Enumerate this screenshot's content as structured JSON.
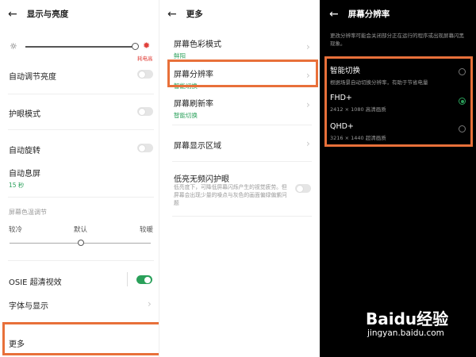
{
  "panel1": {
    "title": "显示与亮度",
    "power_label": "耗电高",
    "auto_brightness": "自动调节亮度",
    "eye_protection": "护眼模式",
    "auto_rotate": "自动旋转",
    "auto_sleep": "自动息屏",
    "auto_sleep_value": "15 秒",
    "color_temp": "屏幕色温调节",
    "temp_cold": "较冷",
    "temp_default": "默认",
    "temp_warm": "较暖",
    "osie": "OSIE 超清视效",
    "font_display": "字体与显示",
    "more": "更多"
  },
  "panel2": {
    "title": "更多",
    "color_mode": "屏幕色彩模式",
    "color_mode_value": "鲜阳",
    "resolution": "屏幕分辨率",
    "resolution_value": "智能切换",
    "refresh": "屏幕刷新率",
    "refresh_value": "智能切换",
    "display_area": "屏幕显示区域",
    "flicker": "低亮无频闪护眼",
    "flicker_desc": "低亮度下，可降低屏幕闪烁产生的视觉疲劳。但屏幕会出现少量的噪点与灰色的画面偏绿偏紫问题"
  },
  "panel3": {
    "title": "屏幕分辨率",
    "desc": "更改分辨率可能会关闭部分正在运行的程序或出现屏幕闪黑现象。",
    "options": [
      {
        "label": "智能切换",
        "desc": "根据场景自动切换分辨率，有助于节省电量"
      },
      {
        "label": "FHD+",
        "desc": "2412 × 1080 高清画质"
      },
      {
        "label": "QHD+",
        "desc": "3216 × 1440 超清画质"
      }
    ],
    "selected": "FHD+"
  },
  "watermark": {
    "logo": "Baidu经验",
    "url": "jingyan.baidu.com"
  },
  "colors": {
    "accent_green": "#2aa05a",
    "highlight": "#e8703a",
    "power_red": "#e0403a"
  }
}
